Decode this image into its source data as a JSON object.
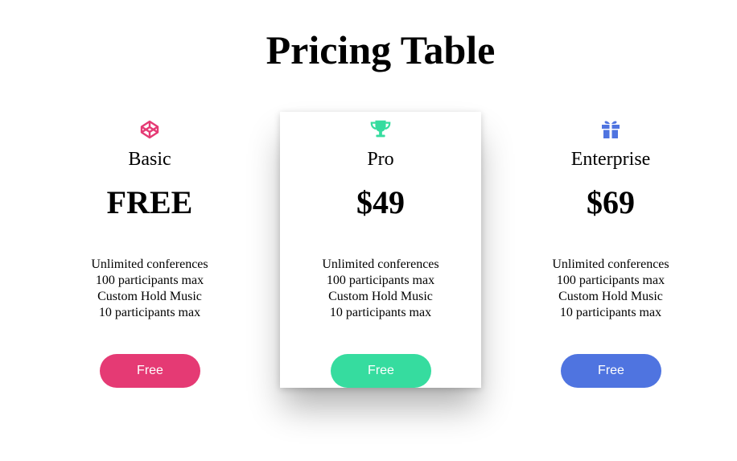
{
  "page": {
    "title": "Pricing Table"
  },
  "plans": [
    {
      "icon": "codepen-cube-icon",
      "name": "Basic",
      "price": "FREE",
      "features": [
        "Unlimited conferences",
        "100 participants max",
        "Custom Hold Music",
        "10 participants max"
      ],
      "button_label": "Free",
      "accent": "#e53a74"
    },
    {
      "icon": "trophy-icon",
      "name": "Pro",
      "price": "$49",
      "features": [
        "Unlimited conferences",
        "100 participants max",
        "Custom Hold Music",
        "10 participants max"
      ],
      "button_label": "Free",
      "accent": "#36dc9f",
      "highlighted": true
    },
    {
      "icon": "gift-icon",
      "name": "Enterprise",
      "price": "$69",
      "features": [
        "Unlimited conferences",
        "100 participants max",
        "Custom Hold Music",
        "10 participants max"
      ],
      "button_label": "Free",
      "accent": "#4f74e0"
    }
  ]
}
